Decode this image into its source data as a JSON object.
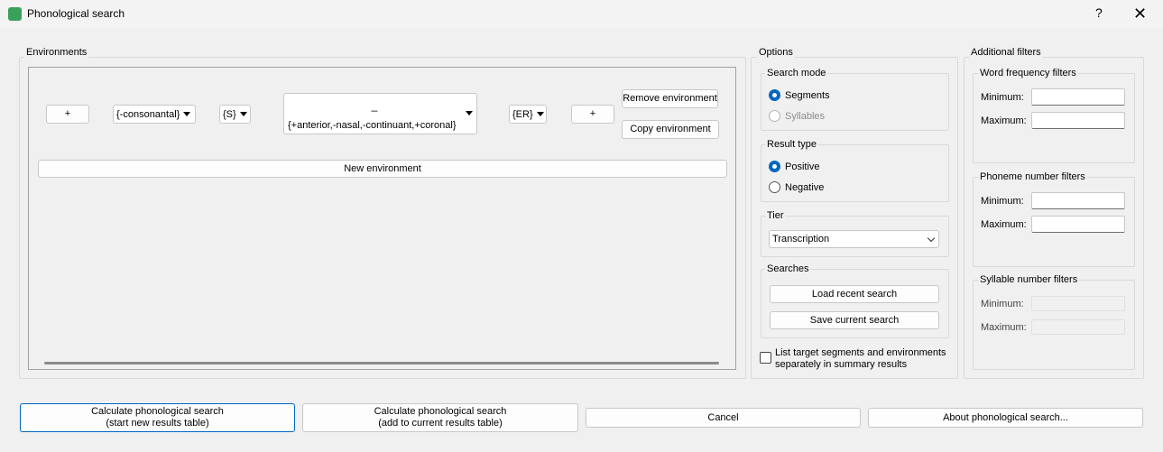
{
  "window": {
    "title": "Phonological search",
    "help": "?",
    "close": "✕"
  },
  "environments": {
    "label": "Environments",
    "row": {
      "add_left": "+",
      "env_lhs1": "{-consonantal}",
      "env_lhs2": "{S}",
      "target_line1": "_",
      "target_line2": "{+anterior,-nasal,-continuant,+coronal}",
      "env_rhs1": "{ER}",
      "add_right": "+",
      "remove": "Remove environment",
      "copy": "Copy environment"
    },
    "new_env": "New environment"
  },
  "options": {
    "label": "Options",
    "search_mode": {
      "label": "Search mode",
      "segments": "Segments",
      "syllables": "Syllables"
    },
    "result_type": {
      "label": "Result type",
      "positive": "Positive",
      "negative": "Negative"
    },
    "tier": {
      "label": "Tier",
      "value": "Transcription"
    },
    "searches": {
      "label": "Searches",
      "load": "Load recent search",
      "save": "Save current search"
    },
    "list_checkbox": "List target segments and environments",
    "list_checkbox2": "separately in summary results"
  },
  "filters": {
    "label": "Additional filters",
    "word_freq": {
      "label": "Word frequency filters",
      "min": "Minimum:",
      "max": "Maximum:"
    },
    "phoneme_num": {
      "label": "Phoneme number filters",
      "min": "Minimum:",
      "max": "Maximum:"
    },
    "syllable_num": {
      "label": "Syllable number filters",
      "min": "Minimum:",
      "max": "Maximum:"
    }
  },
  "bottom": {
    "calc_new_1": "Calculate phonological search",
    "calc_new_2": "(start new results table)",
    "calc_add_1": "Calculate phonological search",
    "calc_add_2": "(add to current results table)",
    "cancel": "Cancel",
    "about": "About phonological search..."
  }
}
